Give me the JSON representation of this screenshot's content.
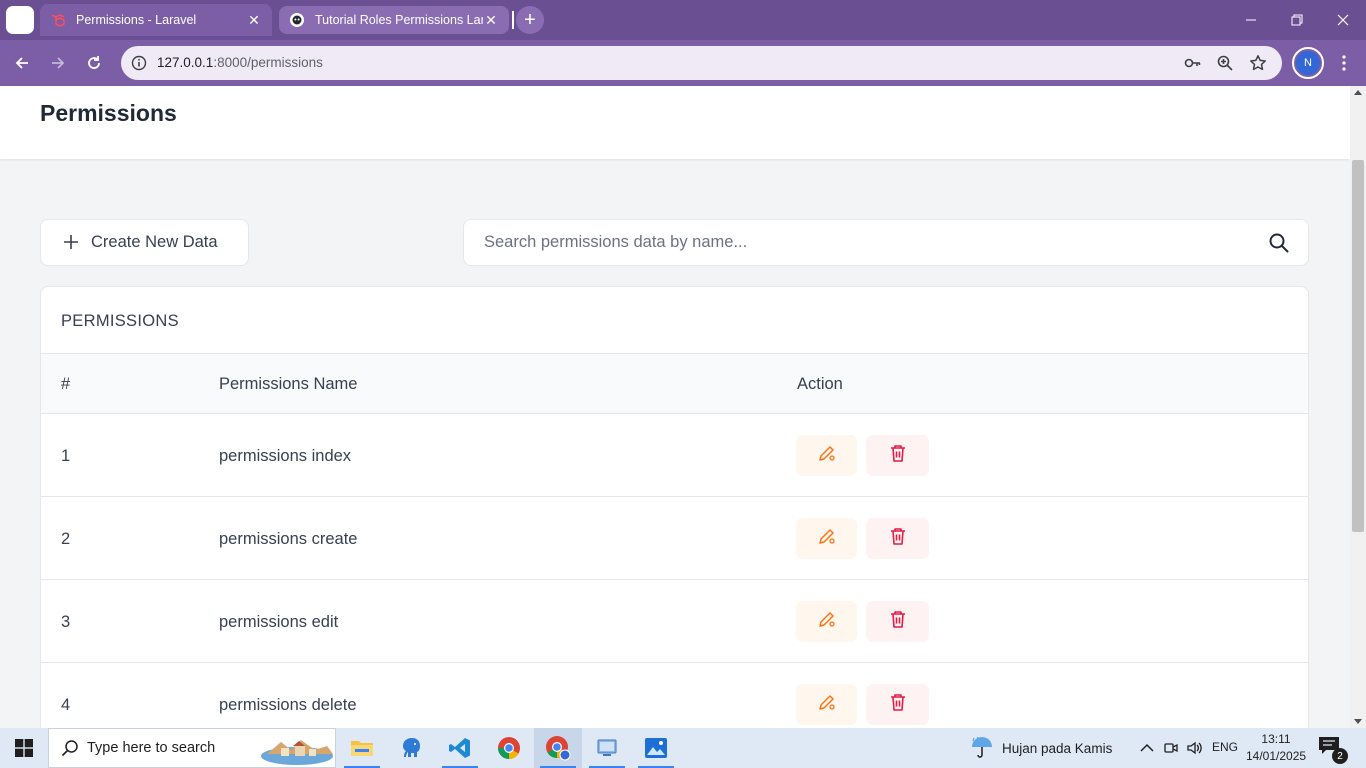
{
  "browser": {
    "tabs": [
      {
        "title": "Permissions - Laravel",
        "active": true,
        "icon": "laravel-icon"
      },
      {
        "title": "Tutorial Roles Permissions Lara",
        "active": false,
        "icon": "github-icon"
      }
    ],
    "url_host": "127.0.0.1",
    "url_path": ":8000/permissions",
    "profile_initial": "N",
    "accent_color": "#7c5ea6"
  },
  "page": {
    "title": "Permissions",
    "create_button_label": "Create New Data",
    "search_placeholder": "Search permissions data by name...",
    "search_value": ""
  },
  "table": {
    "card_title": "PERMISSIONS",
    "headers": {
      "number": "#",
      "name": "Permissions Name",
      "action": "Action"
    },
    "rows": [
      {
        "number": "1",
        "name": "permissions index"
      },
      {
        "number": "2",
        "name": "permissions create"
      },
      {
        "number": "3",
        "name": "permissions edit"
      },
      {
        "number": "4",
        "name": "permissions delete"
      }
    ],
    "edit_color": "#f97316",
    "delete_color": "#e11d48"
  },
  "taskbar": {
    "search_placeholder": "Type here to search",
    "weather": "Hujan pada Kamis",
    "language": "ENG",
    "time": "13:11",
    "date": "14/01/2025",
    "notification_count": "2"
  }
}
